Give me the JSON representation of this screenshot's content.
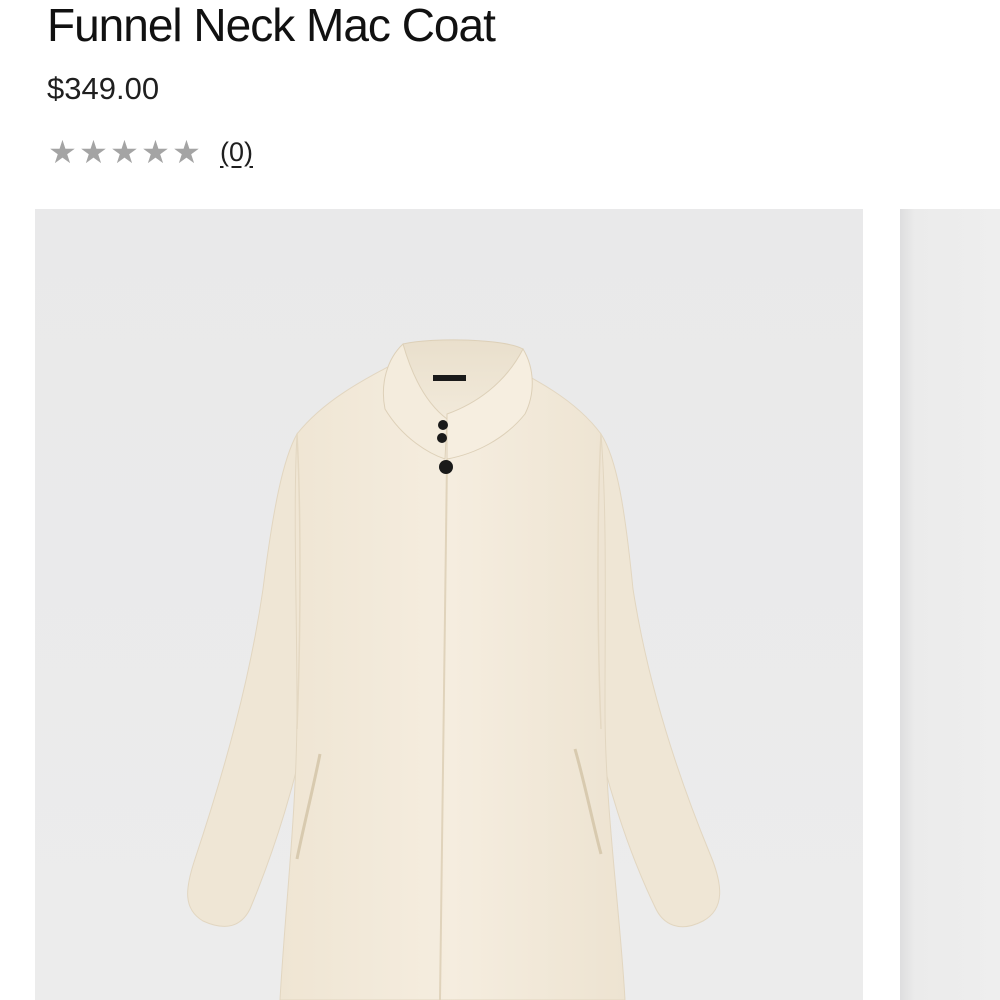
{
  "product": {
    "title": "Funnel Neck Mac Coat",
    "price": "$349.00",
    "rating": {
      "stars_filled": 0,
      "stars_total": 5,
      "review_count_label": "(0)",
      "star_color": "#a4a4a4"
    }
  },
  "gallery": {
    "current_image": "cream funnel neck mac coat",
    "background_color": "#ebebeb",
    "coat_color": "#f3ebdc",
    "button_color": "#1a1a1a"
  }
}
